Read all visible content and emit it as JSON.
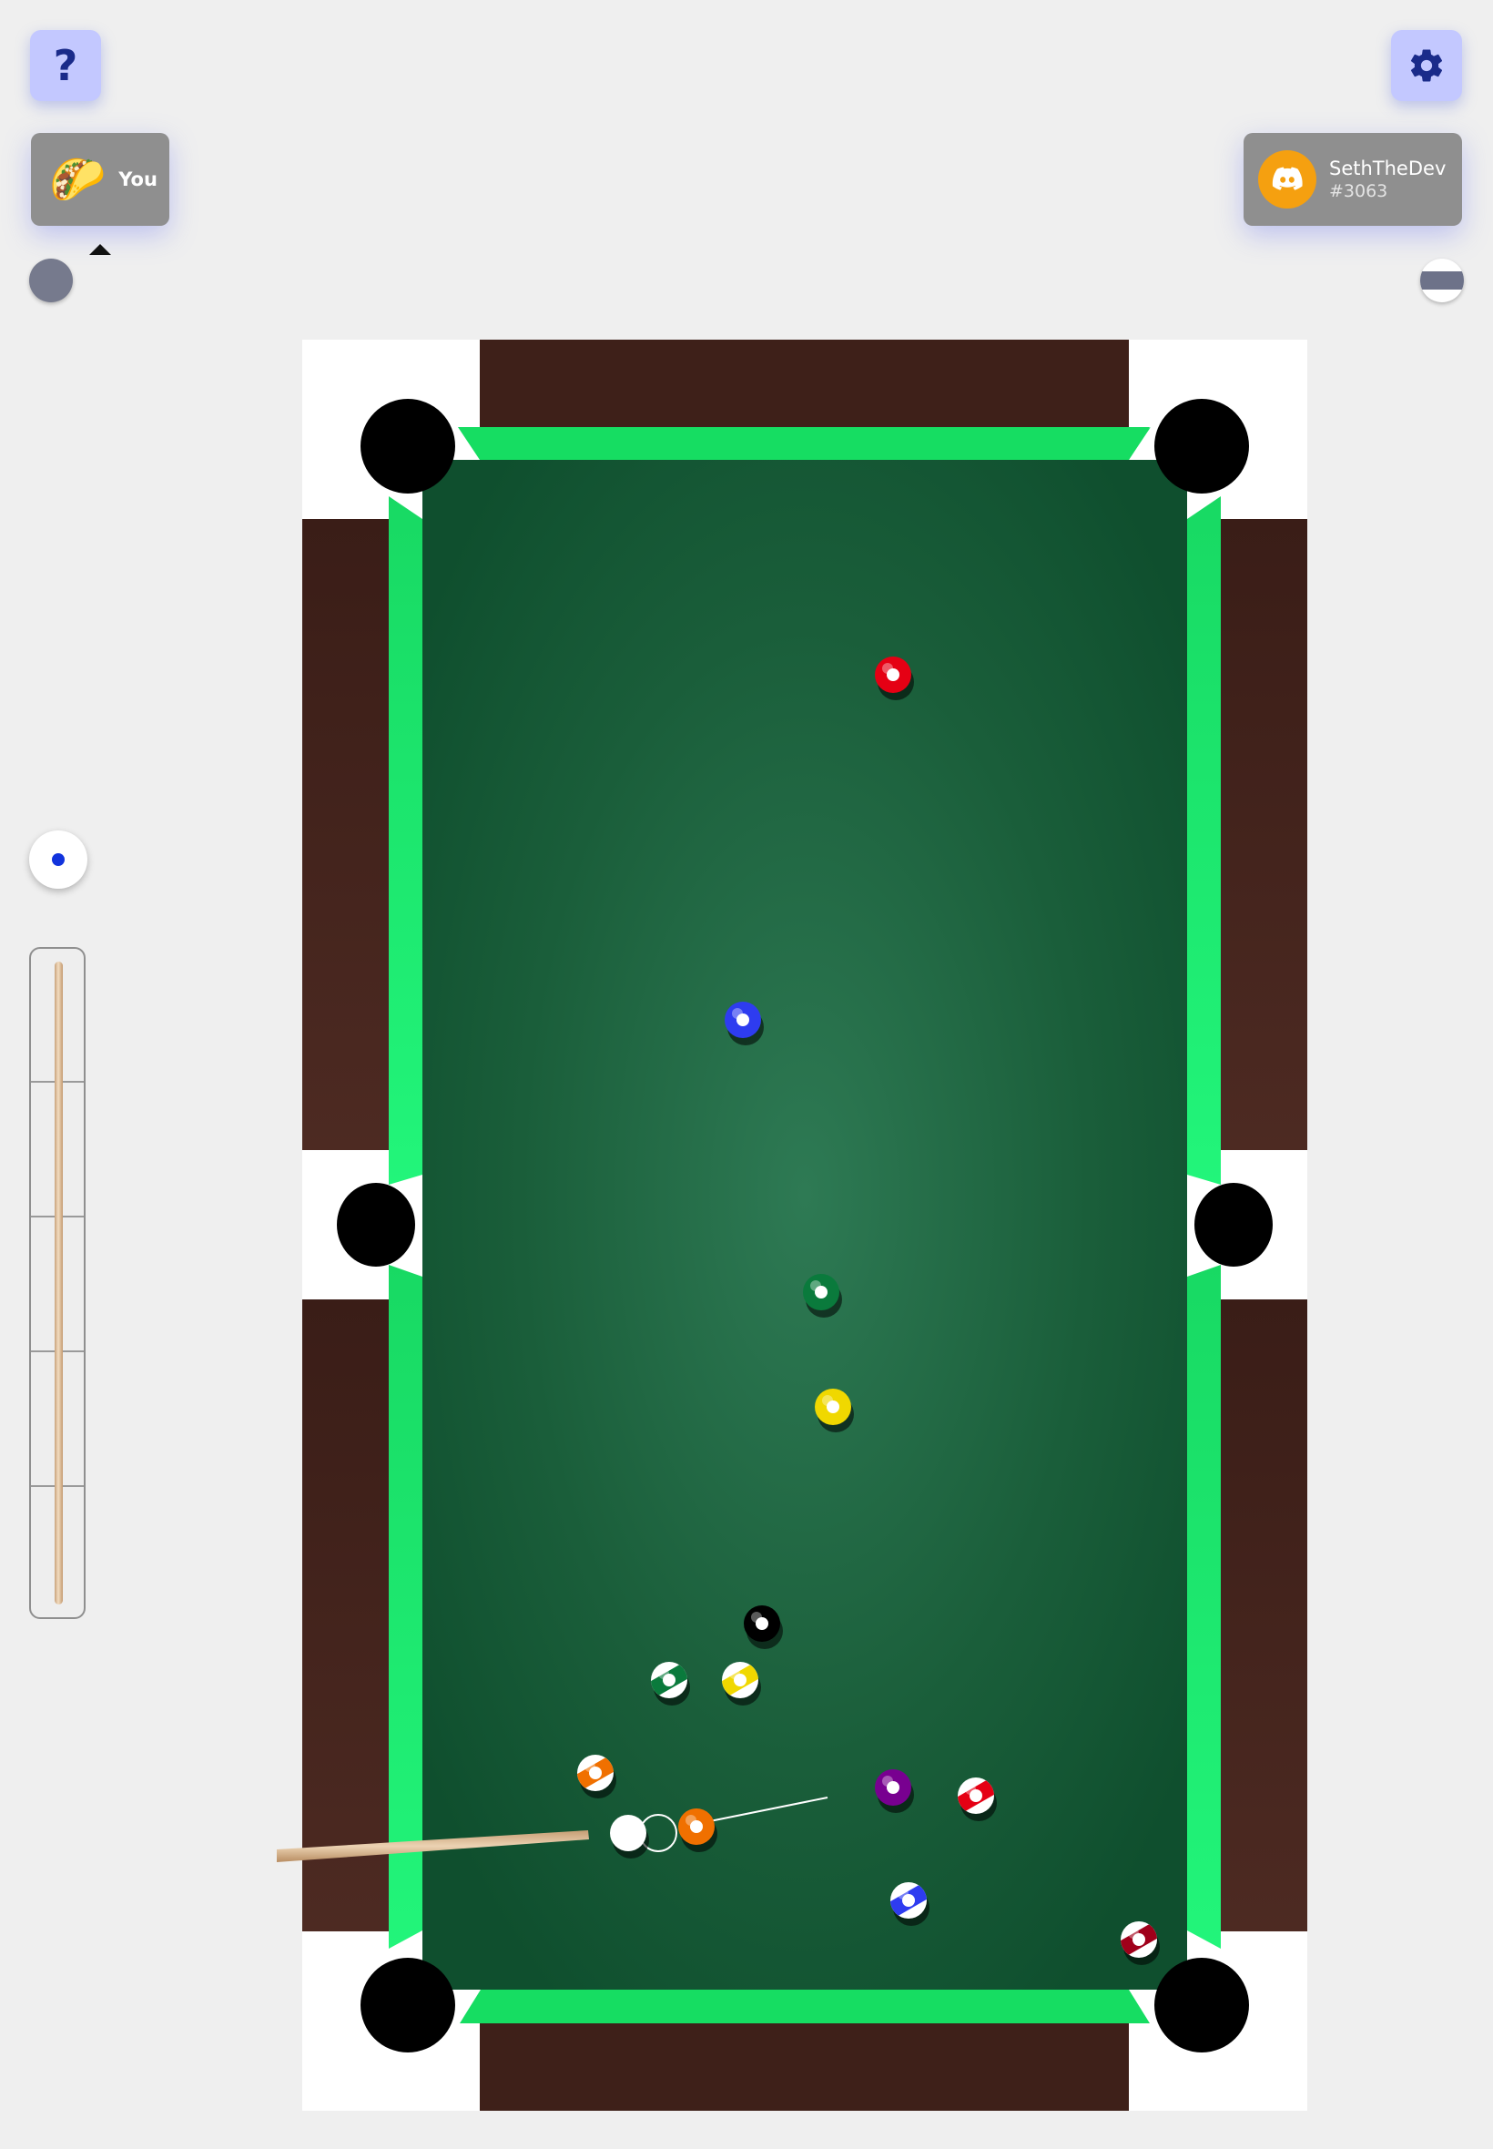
{
  "help_button": {
    "label": "?",
    "icon": "help-icon"
  },
  "settings_button": {
    "icon": "gear-icon"
  },
  "player_you": {
    "avatar": "taco-emoji",
    "avatar_glyph": "🌮",
    "name": "You"
  },
  "player_opponent": {
    "avatar": "discord-logo",
    "name": "SethTheDev",
    "tag": "#3063"
  },
  "turn_indicator": "player_you",
  "group_you": "solids",
  "group_opponent": "stripes",
  "spin": {
    "x": 0,
    "y": 0
  },
  "power_meter": {
    "level": 0
  },
  "colors": {
    "background": "#efefef",
    "button": "#c3c8ff",
    "felt_center": "#2e7a54",
    "felt_edge": "#0f4f2e",
    "cushion": "#1ee063",
    "rail_wood": "#3e2019",
    "pocket": "#000000",
    "cue_wood": "#d9b58c",
    "discord_orange": "#f5a010"
  },
  "balls": [
    {
      "number": 1,
      "color": "#f0d800",
      "type": "solid"
    },
    {
      "number": 3,
      "color": "#e50014",
      "type": "solid"
    },
    {
      "number": 2,
      "color": "#2e3cf0",
      "type": "solid"
    },
    {
      "number": 5,
      "color": "#f07000",
      "type": "solid"
    },
    {
      "number": 4,
      "color": "#780090",
      "type": "solid"
    },
    {
      "number": 6,
      "color": "#0a7a3c",
      "type": "solid"
    },
    {
      "number": 8,
      "color": "#000000",
      "type": "solid"
    },
    {
      "number": 9,
      "color": "#f0d800",
      "type": "stripe"
    },
    {
      "number": 10,
      "color": "#2e3cf0",
      "type": "stripe"
    },
    {
      "number": 11,
      "color": "#e50014",
      "type": "stripe"
    },
    {
      "number": 13,
      "color": "#f07000",
      "type": "stripe"
    },
    {
      "number": 14,
      "color": "#0a7a3c",
      "type": "stripe"
    },
    {
      "number": 15,
      "color": "#a0001a",
      "type": "stripe"
    },
    {
      "number": 0,
      "color": "#ffffff",
      "type": "cue"
    }
  ]
}
